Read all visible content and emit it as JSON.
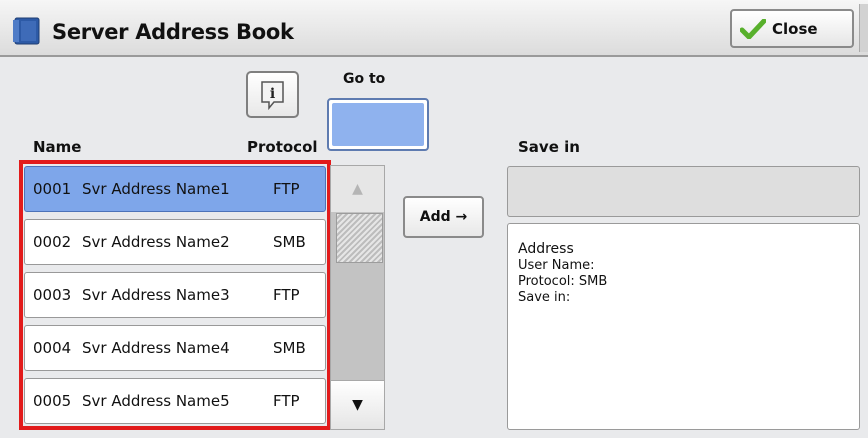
{
  "window": {
    "title": "Server Address Book",
    "close_label": "Close",
    "title_icon": "address-book-icon",
    "close_icon": "checkmark-icon"
  },
  "goto": {
    "label": "Go to",
    "value": ""
  },
  "info_button": {
    "icon": "info-icon"
  },
  "columns": {
    "name": "Name",
    "protocol": "Protocol",
    "save_in": "Save in"
  },
  "list": {
    "rows": [
      {
        "num": "0001",
        "name": "Svr Address Name1",
        "protocol": "FTP",
        "selected": true
      },
      {
        "num": "0002",
        "name": "Svr Address Name2",
        "protocol": "SMB",
        "selected": false
      },
      {
        "num": "0003",
        "name": "Svr Address Name3",
        "protocol": "FTP",
        "selected": false
      },
      {
        "num": "0004",
        "name": "Svr Address Name4",
        "protocol": "SMB",
        "selected": false
      },
      {
        "num": "0005",
        "name": "Svr Address Name5",
        "protocol": "FTP",
        "selected": false
      }
    ]
  },
  "scroll": {
    "up": "▲",
    "down": "▼"
  },
  "add_label": "Add →",
  "save_in_value": "",
  "details": {
    "address": "Address",
    "user_name": "User Name:",
    "protocol": "Protocol: SMB",
    "save_in": "Save in:"
  },
  "colors": {
    "selected_row": "#7ea6ea",
    "highlight_border": "#e21b1b",
    "goto_fill": "#8fb2ee",
    "checkmark": "#58b02c"
  }
}
